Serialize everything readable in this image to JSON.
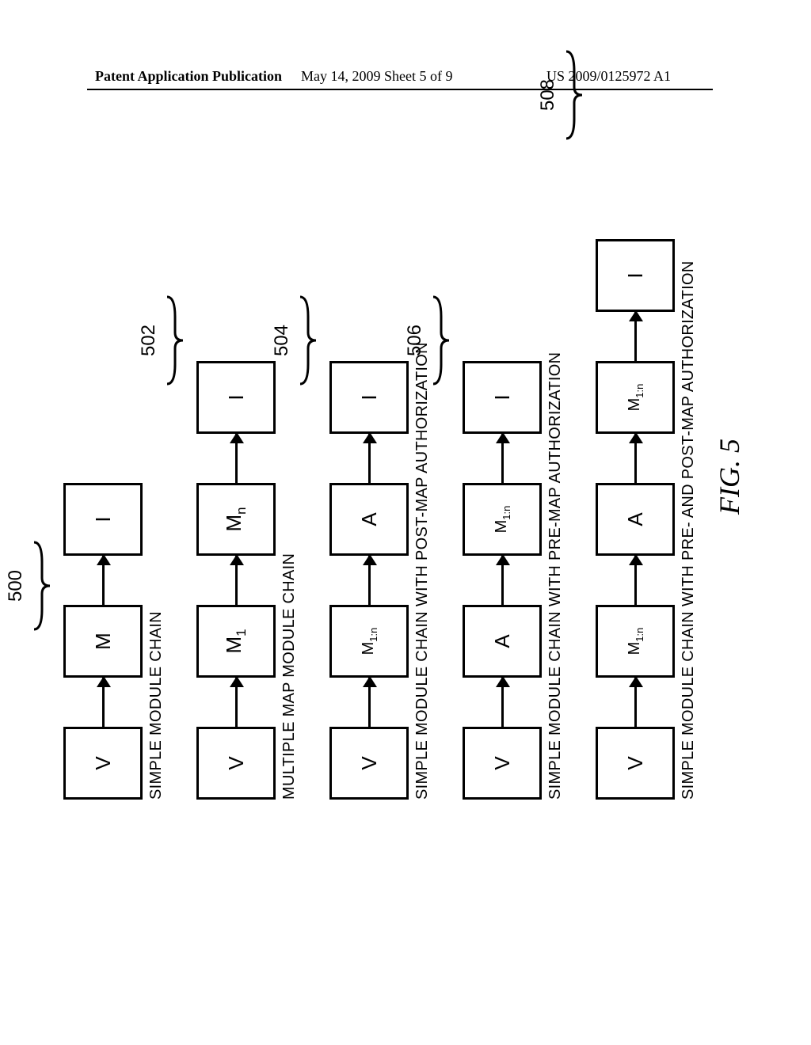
{
  "header": {
    "left": "Patent Application Publication",
    "center": "May 14, 2009  Sheet 5 of 9",
    "right": "US 2009/0125972 A1"
  },
  "figure_label": "FIG. 5",
  "chains": {
    "c1": {
      "ref": "500",
      "nodes": [
        "V",
        "M",
        "I"
      ],
      "caption": "SIMPLE MODULE CHAIN"
    },
    "c2": {
      "ref": "502",
      "nodes": [
        "V",
        "M₁",
        "Mₙ",
        "I"
      ],
      "node1_sub": "1",
      "node2_sub": "n",
      "caption": "MULTIPLE MAP MODULE CHAIN"
    },
    "c3": {
      "ref": "504",
      "nodes_plain": [
        "V",
        "",
        "A",
        "I"
      ],
      "m_label": "M",
      "m_sub": "1:n",
      "caption": "SIMPLE MODULE CHAIN WITH POST-MAP AUTHORIZATION"
    },
    "c4": {
      "ref": "506",
      "nodes_plain": [
        "V",
        "A",
        "",
        "I"
      ],
      "m_label": "M",
      "m_sub": "1:n",
      "caption": "SIMPLE MODULE CHAIN WITH PRE-MAP AUTHORIZATION"
    },
    "c5": {
      "ref": "508",
      "nodes_plain": [
        "V",
        "",
        "A",
        "",
        "I"
      ],
      "m_label": "M",
      "m_sub": "1:n",
      "caption": "SIMPLE MODULE CHAIN WITH PRE- AND POST-MAP AUTHORIZATION"
    }
  },
  "chart_data": {
    "type": "table",
    "title": "FIG. 5",
    "rows": [
      {
        "ref": "500",
        "sequence": [
          "V",
          "M",
          "I"
        ],
        "label": "SIMPLE MODULE CHAIN"
      },
      {
        "ref": "502",
        "sequence": [
          "V",
          "M1",
          "Mn",
          "I"
        ],
        "label": "MULTIPLE MAP MODULE CHAIN"
      },
      {
        "ref": "504",
        "sequence": [
          "V",
          "M1:n",
          "A",
          "I"
        ],
        "label": "SIMPLE MODULE CHAIN WITH POST-MAP AUTHORIZATION"
      },
      {
        "ref": "506",
        "sequence": [
          "V",
          "A",
          "M1:n",
          "I"
        ],
        "label": "SIMPLE MODULE CHAIN WITH PRE-MAP AUTHORIZATION"
      },
      {
        "ref": "508",
        "sequence": [
          "V",
          "M1:n",
          "A",
          "M1:n",
          "I"
        ],
        "label": "SIMPLE MODULE CHAIN WITH PRE- AND POST-MAP AUTHORIZATION"
      }
    ]
  }
}
